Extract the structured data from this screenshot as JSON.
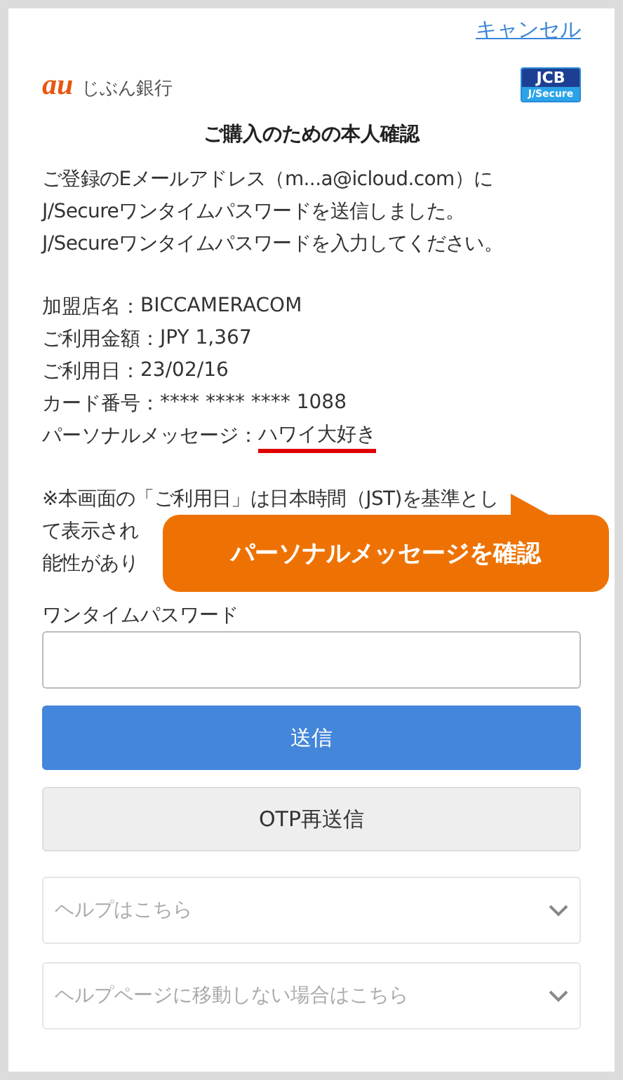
{
  "cancel_link": "キャンセル",
  "bank_logo": {
    "mark": "au",
    "name": "じぶん銀行"
  },
  "badge": {
    "top": "JCB",
    "bottom": "J/Secure"
  },
  "title": "ご購入のための本人確認",
  "intro": [
    "ご登録のEメールアドレス（m...a@icloud.com）に",
    "J/Secureワンタイムパスワードを送信しました。",
    "J/Secureワンタイムパスワードを入力してください。"
  ],
  "details": [
    {
      "label": "加盟店名：",
      "value": "BICCAMERACOM",
      "highlighted": false
    },
    {
      "label": "ご利用金額：",
      "value": "JPY 1,367",
      "highlighted": false
    },
    {
      "label": "ご利用日：",
      "value": "23/02/16",
      "highlighted": false
    },
    {
      "label": "カード番号：",
      "value": "**** **** **** 1088",
      "highlighted": false
    },
    {
      "label": "パーソナルメッセージ：",
      "value": "ハワイ大好き",
      "highlighted": true
    }
  ],
  "notice": [
    "※本画面の「ご利用日」は日本時間（JST)を基準とし",
    "て表示され",
    "能性があり"
  ],
  "callout": "パーソナルメッセージを確認",
  "otp": {
    "label": "ワンタイムパスワード"
  },
  "buttons": [
    {
      "label": "送信",
      "kind": "primary"
    },
    {
      "label": "OTP再送信",
      "kind": "secondary"
    }
  ],
  "help": [
    {
      "label": "ヘルプはこちら",
      "expanded": false
    },
    {
      "label": "ヘルプページに移動しない場合はこちら",
      "expanded": false
    }
  ]
}
